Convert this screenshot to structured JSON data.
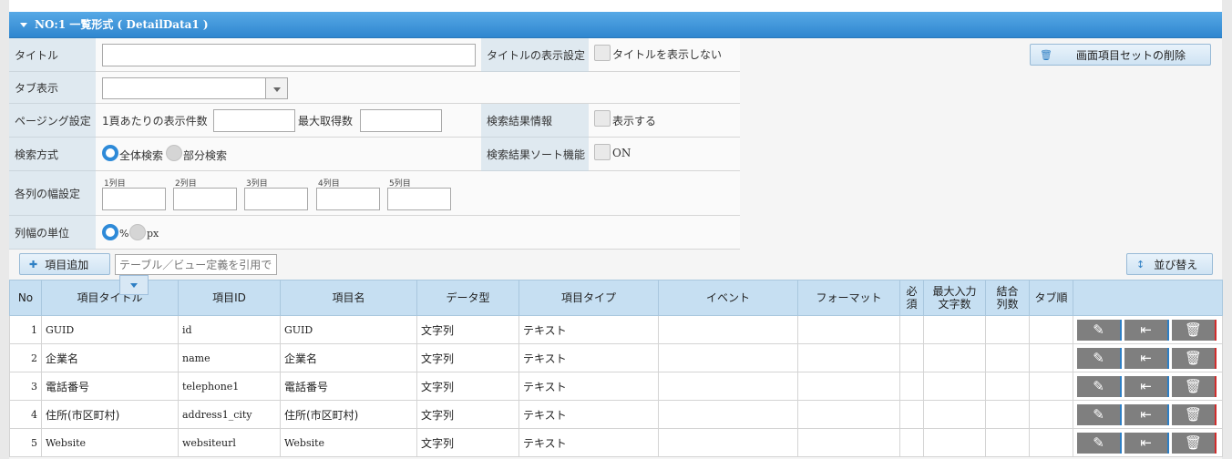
{
  "section": {
    "title": "NO:1 一覧形式 ( DetailData1 )"
  },
  "form": {
    "title_label": "タイトル",
    "title_value": "",
    "title_display_label": "タイトルの表示設定",
    "hide_title_label": "タイトルを表示しない",
    "tab_label": "タブ表示",
    "tab_value": "",
    "paging_label": "ページング設定",
    "per_page_label": "1頁あたりの表示件数",
    "per_page_value": "",
    "max_label": "最大取得数",
    "max_value": "",
    "result_info_label": "検索結果情報",
    "show_label": "表示する",
    "search_mode_label": "検索方式",
    "search_all": "全体検索",
    "search_partial": "部分検索",
    "sort_label": "検索結果ソート機能",
    "sort_on": "ON",
    "col_width_label": "各列の幅設定",
    "cols": [
      "1列目",
      "2列目",
      "3列目",
      "4列目",
      "5列目"
    ],
    "unit_label": "列幅の単位",
    "unit_percent": "%",
    "unit_px": "px"
  },
  "toolbar": {
    "delete_set": "画面項目セットの削除",
    "add_item": "項目追加",
    "table_ref_placeholder": "テーブル／ビュー定義を引用で",
    "sort": "並び替え"
  },
  "table": {
    "headers": [
      "No",
      "項目タイトル",
      "項目ID",
      "項目名",
      "データ型",
      "項目タイプ",
      "イベント",
      "フォーマット",
      "必須",
      "最大入力文字数",
      "結合列数",
      "タブ順",
      ""
    ],
    "rows": [
      {
        "no": "1",
        "title": "GUID",
        "id": "id",
        "name": "GUID",
        "type": "文字列",
        "itype": "テキスト"
      },
      {
        "no": "2",
        "title": "企業名",
        "id": "name",
        "name": "企業名",
        "type": "文字列",
        "itype": "テキスト"
      },
      {
        "no": "3",
        "title": "電話番号",
        "id": "telephone1",
        "name": "電話番号",
        "type": "文字列",
        "itype": "テキスト"
      },
      {
        "no": "4",
        "title": "住所(市区町村)",
        "id": "address1_city",
        "name": "住所(市区町村)",
        "type": "文字列",
        "itype": "テキスト"
      },
      {
        "no": "5",
        "title": "Website",
        "id": "websiteurl",
        "name": "Website",
        "type": "文字列",
        "itype": "テキスト"
      }
    ]
  }
}
